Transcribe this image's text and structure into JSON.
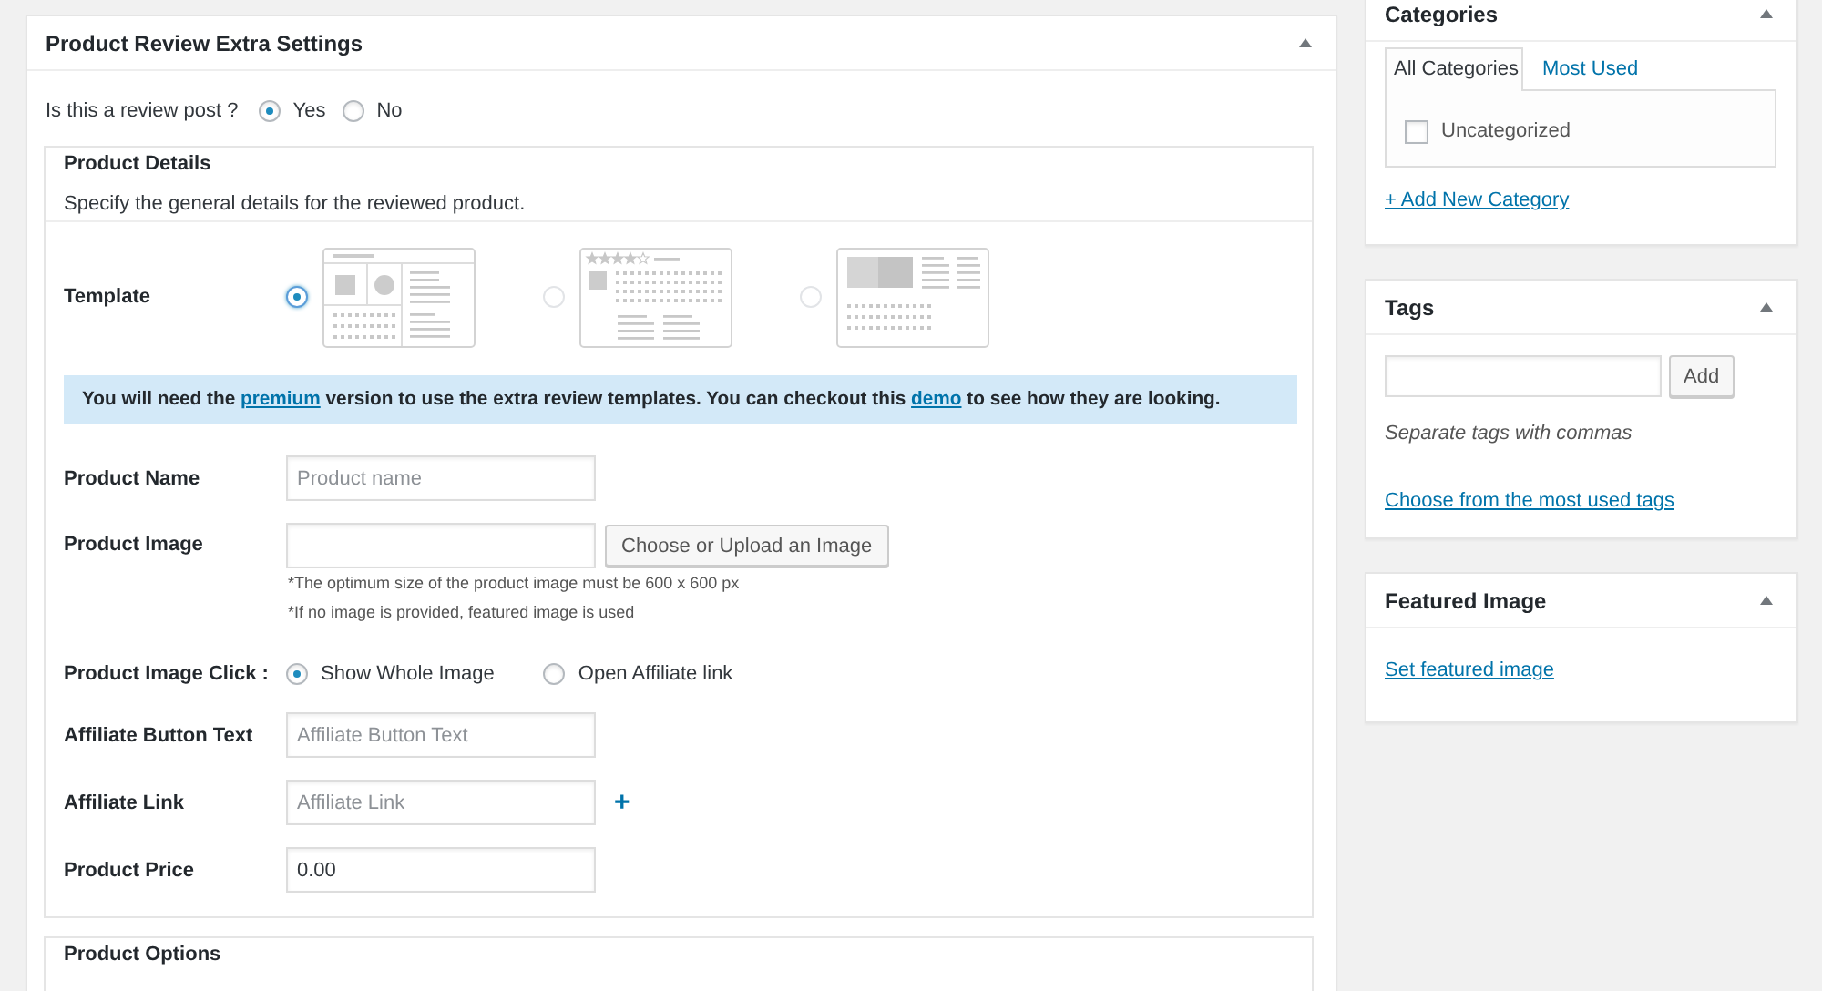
{
  "review_settings": {
    "title": "Product Review Extra Settings",
    "review_post": {
      "label": "Is this a review post ?",
      "options": [
        {
          "label": "Yes",
          "selected": true
        },
        {
          "label": "No",
          "selected": false
        }
      ]
    },
    "product_details": {
      "title": "Product Details",
      "description": "Specify the general details for the reviewed product.",
      "template": {
        "label": "Template",
        "options": [
          {
            "kind": "split",
            "selected": true
          },
          {
            "kind": "stars",
            "selected": false
          },
          {
            "kind": "banner",
            "selected": false
          }
        ]
      },
      "notice": [
        {
          "kind": "text",
          "text": "You will need the "
        },
        {
          "kind": "link",
          "text": "premium"
        },
        {
          "kind": "text",
          "text": " version to use the extra review templates. You can checkout this "
        },
        {
          "kind": "link",
          "text": "demo"
        },
        {
          "kind": "text",
          "text": " to see how they are looking."
        }
      ],
      "fields": [
        {
          "kind": "input",
          "label": "Product Name",
          "placeholder": "Product name"
        },
        {
          "kind": "image",
          "label": "Product Image",
          "button": "Choose or Upload an Image",
          "notes": [
            "*The optimum size of the product image must be 600 x 600 px",
            "*If no image is provided, featured image is used"
          ]
        },
        {
          "kind": "radio",
          "label": "Product Image Click :",
          "options": [
            {
              "label": "Show Whole Image",
              "selected": true
            },
            {
              "label": "Open Affiliate link",
              "selected": false
            }
          ]
        },
        {
          "kind": "input",
          "label": "Affiliate Button Text",
          "placeholder": "Affiliate Button Text"
        },
        {
          "kind": "input",
          "label": "Affiliate Link",
          "placeholder": "Affiliate Link",
          "add_button": "+"
        },
        {
          "kind": "input",
          "label": "Product Price",
          "value": "0.00"
        }
      ]
    },
    "product_options": {
      "title": "Product Options"
    }
  },
  "sidebar": {
    "categories": {
      "title": "Categories",
      "tabs": [
        {
          "label": "All Categories",
          "selected": true
        },
        {
          "label": "Most Used",
          "selected": false
        }
      ],
      "items": [
        {
          "label": "Uncategorized",
          "checked": false
        }
      ],
      "add_link": "+ Add New Category"
    },
    "tags": {
      "title": "Tags",
      "button": "Add",
      "hint": "Separate tags with commas",
      "link": "Choose from the most used tags"
    },
    "featured_image": {
      "title": "Featured Image",
      "link": "Set featured image"
    }
  }
}
